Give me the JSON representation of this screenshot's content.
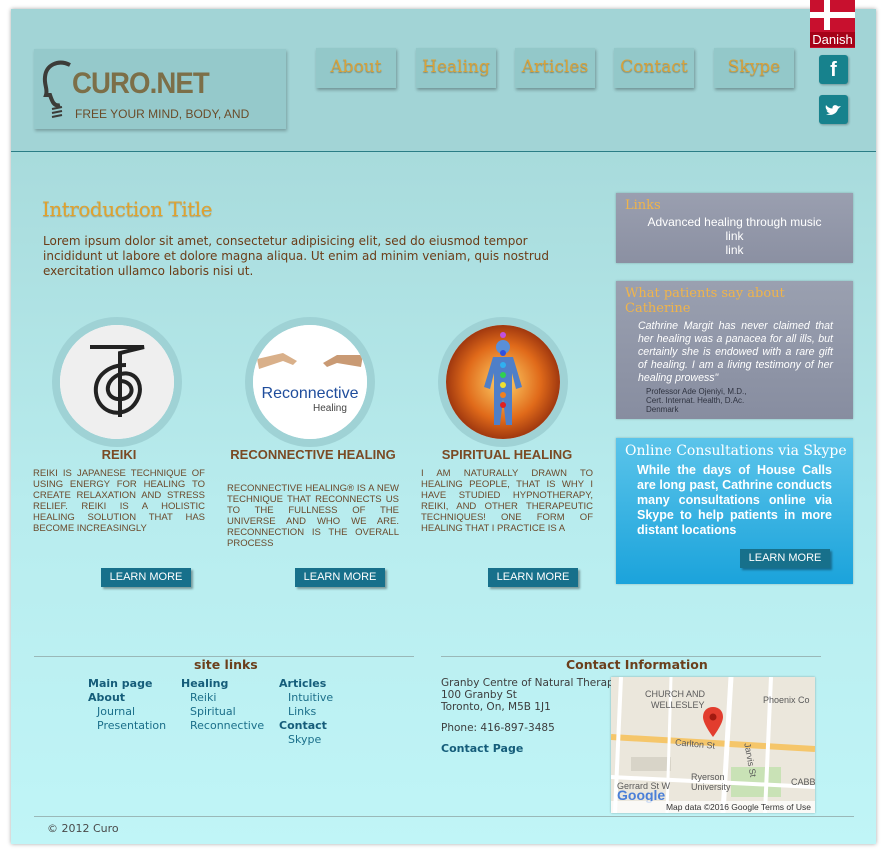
{
  "language_flag": {
    "label": "Danish"
  },
  "logo": {
    "title": "CURO.NET",
    "tagline": "FREE YOUR MIND, BODY, AND"
  },
  "nav": [
    {
      "label": "About"
    },
    {
      "label": "Healing"
    },
    {
      "label": "Articles"
    },
    {
      "label": "Contact"
    },
    {
      "label": "Skype"
    }
  ],
  "social": {
    "facebook_glyph": "f",
    "twitter_glyph": "t"
  },
  "intro": {
    "title": "Introduction Title",
    "text": "Lorem ipsum dolor sit amet, consectetur adipisicing elit, sed do eiusmod tempor incididunt ut labore et dolore magna aliqua. Ut enim ad minim veniam, quis nostrud exercitation ullamco laboris nisi ut."
  },
  "services": [
    {
      "title": "REIKI",
      "desc": "Reiki is Japanese technique of using energy for healing to create relaxation and stress relief. Reiki is a holistic healing solution that has become increasingly",
      "button": "LEARN MORE",
      "icon": "reiki-symbol-icon"
    },
    {
      "title": "RECONNECTIVE HEALING",
      "desc": "Reconnective Healing® is a new technique that reconnects us to the fullness of the universe and who we are. Reconnection is the overall process",
      "button": "LEARN MORE",
      "image_text": "Reconnective",
      "image_subtext": "Healing"
    },
    {
      "title": "SPIRITUAL HEALING",
      "desc": "I am naturally drawn to healing people, that is why I have studied hypnotherapy, reiki, and other therapeutic techniques! One form of healing that I practice is a",
      "button": "LEARN MORE",
      "icon": "chakra-figure-icon"
    }
  ],
  "links_panel": {
    "heading": "Links",
    "items": [
      "Advanced healing through music",
      "link",
      "link"
    ]
  },
  "testimonial_panel": {
    "heading": "What patients say about Catherine",
    "quote": "Cathrine Margit has never claimed that her healing was a panacea for all ills, but certainly she is endowed with a rare gift of healing. I am a living testimony of her healing prowess\"",
    "author_lines": [
      "Professor Ade Ojeniyi, M.D.,",
      "Cert. Internat. Health, D.Ac.",
      "Denmark"
    ]
  },
  "skype_panel": {
    "heading": "Online Consultations via Skype",
    "text": "While the days of House Calls are long past, Cathrine conducts many consultations online via Skype to help patients in more distant locations",
    "button": "LEARN MORE"
  },
  "footer": {
    "site_links_heading": "site links",
    "columns": [
      {
        "items": [
          {
            "label": "Main page",
            "bold": true
          },
          {
            "label": "About",
            "bold": true
          },
          {
            "label": "Journal",
            "bold": false
          },
          {
            "label": "Presentation",
            "bold": false
          }
        ]
      },
      {
        "items": [
          {
            "label": "Healing",
            "bold": true
          },
          {
            "label": "Reiki",
            "bold": false
          },
          {
            "label": "Spiritual",
            "bold": false
          },
          {
            "label": "Reconnective",
            "bold": false
          }
        ]
      },
      {
        "items": [
          {
            "label": "Articles",
            "bold": true
          },
          {
            "label": "Intuitive",
            "bold": false
          },
          {
            "label": "Links",
            "bold": false
          },
          {
            "label": "Contact",
            "bold": true
          },
          {
            "label": "Skype",
            "bold": false
          }
        ]
      }
    ],
    "contact_heading": "Contact Information",
    "address_lines": [
      "Granby Centre of Natural Therapy",
      "100 Granby St",
      "Toronto, On, M5B 1J1"
    ],
    "phone": "Phone: 416-897-3485",
    "contact_page": "Contact Page",
    "map": {
      "labels": [
        "CHURCH AND",
        "WELLESLEY",
        "Phoenix Co",
        "Carlton St",
        "Ryerson",
        "University",
        "Jarvis St",
        "Gerrard St W",
        "CABB"
      ],
      "attribution": "Map data ©2016 Google  Terms of Use",
      "logo": "Google"
    },
    "copyright": "© 2012 Curo"
  },
  "colors": {
    "header_bg": "#a2d4d6",
    "accent_gold": "#d8a23a",
    "button_teal": "#17708b",
    "skype_blue": "#1ba3db",
    "flag_red": "#c8102e"
  }
}
